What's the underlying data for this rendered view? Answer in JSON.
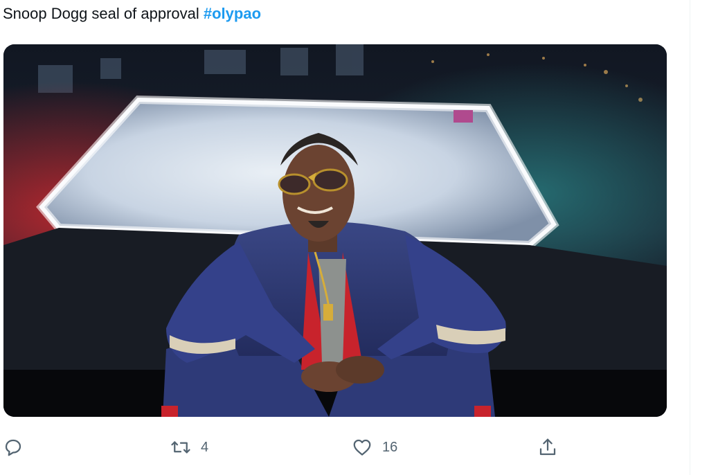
{
  "tweet": {
    "text": "Snoop Dogg seal of approval ",
    "hashtag": "#olypao"
  },
  "media": {
    "description_icon": "photo"
  },
  "actions": {
    "reply": {
      "icon": "reply-icon",
      "count": ""
    },
    "retweet": {
      "icon": "retweet-icon",
      "count": "4"
    },
    "like": {
      "icon": "heart-icon",
      "count": "16"
    },
    "share": {
      "icon": "share-icon",
      "count": ""
    }
  },
  "colors": {
    "text": "#0f1419",
    "hashtag": "#1d9bf0",
    "icon": "#536471"
  }
}
